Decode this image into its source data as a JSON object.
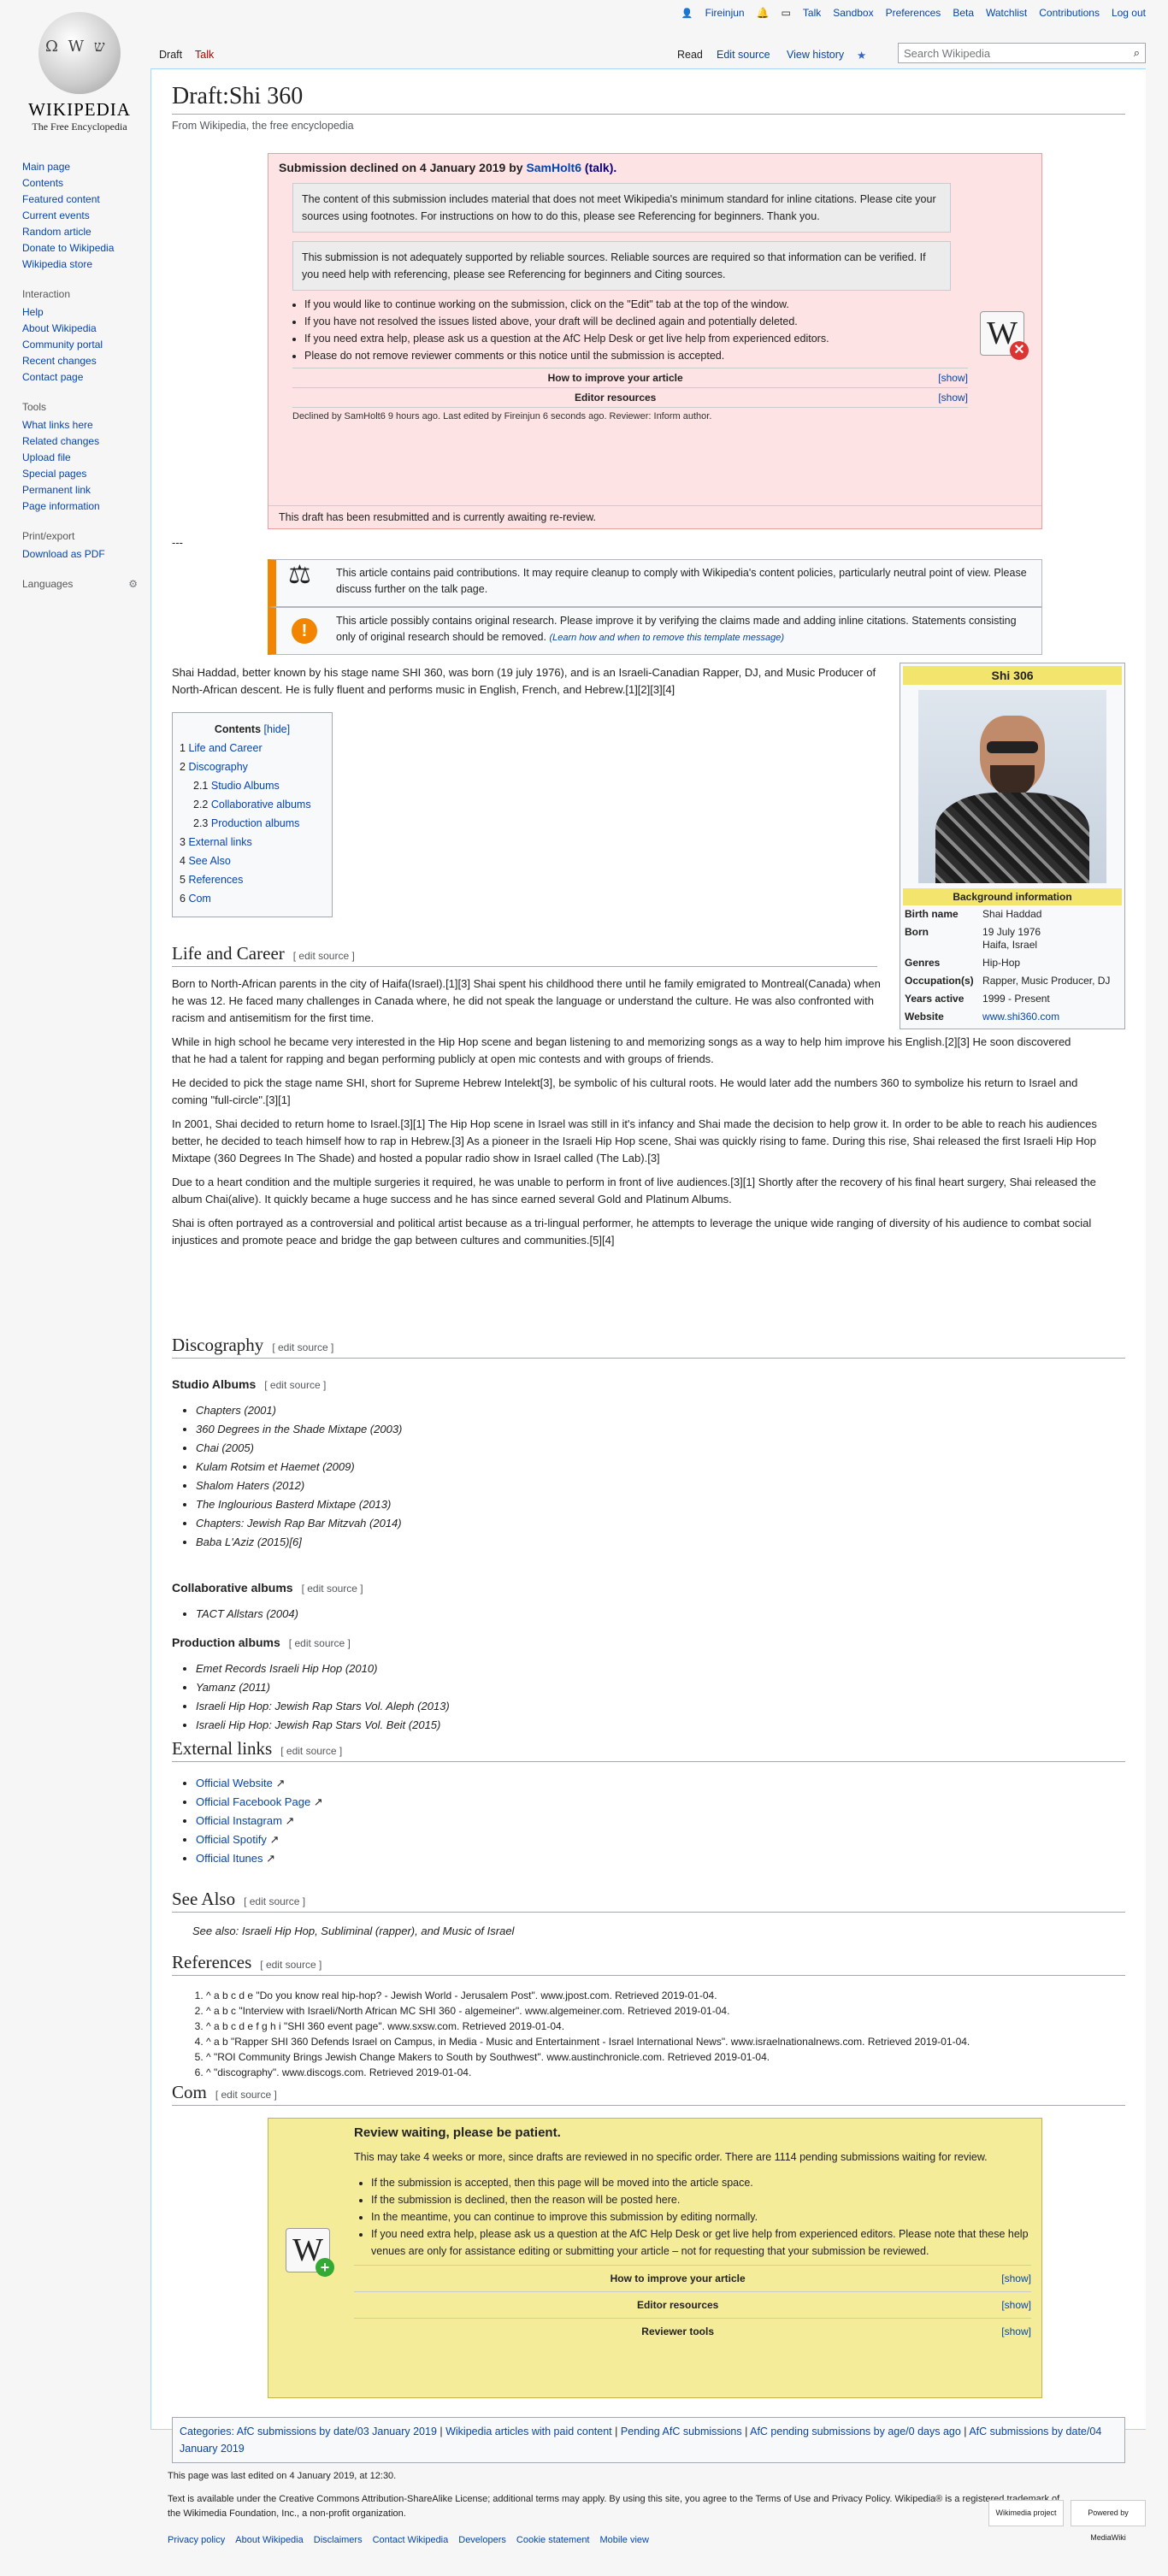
{
  "personal": [
    "Fireinjun",
    "Talk",
    "Sandbox",
    "Preferences",
    "Beta",
    "Watchlist",
    "Contributions",
    "Log out"
  ],
  "logo": {
    "name": "WIKIPEDIA",
    "tagline": "The Free Encyclopedia"
  },
  "sidebar": {
    "main": [
      "Main page",
      "Contents",
      "Featured content",
      "Current events",
      "Random article",
      "Donate to Wikipedia",
      "Wikipedia store"
    ],
    "interaction_head": "Interaction",
    "interaction": [
      "Help",
      "About Wikipedia",
      "Community portal",
      "Recent changes",
      "Contact page"
    ],
    "tools_head": "Tools",
    "tools": [
      "What links here",
      "Related changes",
      "Upload file",
      "Special pages",
      "Permanent link",
      "Page information"
    ],
    "print_head": "Print/export",
    "print": [
      "Download as PDF"
    ],
    "lang_head": "Languages"
  },
  "tabs": {
    "draft": "Draft",
    "talk": "Talk",
    "read": "Read",
    "edit": "Edit source",
    "history": "View history",
    "search_placeholder": "Search Wikipedia"
  },
  "page": {
    "title": "Draft:Shi 360",
    "from": "From Wikipedia, the free encyclopedia",
    "dashes": "---"
  },
  "decline": {
    "title_pre": "Submission declined on 4 January 2019 by ",
    "user": "SamHolt6",
    "talk": "(talk).",
    "reason1": "The content of this submission includes material that does not meet Wikipedia's minimum standard for inline citations. Please cite your sources using footnotes. For instructions on how to do this, please see Referencing for beginners. Thank you.",
    "reason2": "This submission is not adequately supported by reliable sources. Reliable sources are required so that information can be verified. If you need help with referencing, please see Referencing for beginners and Citing sources.",
    "bullets": [
      "If you would like to continue working on the submission, click on the \"Edit\" tab at the top of the window.",
      "If you have not resolved the issues listed above, your draft will be declined again and potentially deleted.",
      "If you need extra help, please ask us a question at the AfC Help Desk or get live help from experienced editors.",
      "Please do not remove reviewer comments or this notice until the submission is accepted."
    ],
    "how": "How to improve your article",
    "editor": "Editor resources",
    "show": "[show]",
    "declined_by": "Declined by SamHolt6 9 hours ago. Last edited by Fireinjun 6 seconds ago. Reviewer: Inform author.",
    "resubmitted": "This draft has been resubmitted and is currently awaiting re-review."
  },
  "issues": {
    "paid": "This article contains paid contributions. It may require cleanup to comply with Wikipedia's content policies, particularly neutral point of view. Please discuss further on the talk page.",
    "research": "This article possibly contains original research. Please improve it by verifying the claims made and adding inline citations. Statements consisting only of original research should be removed.",
    "learn": "(Learn how and when to remove this template message)"
  },
  "intro": "Shai Haddad, better known by his stage name SHI 360, was born (19 july 1976), and is an Israeli-Canadian Rapper, DJ, and Music Producer of North-African descent. He is fully fluent and performs music in English, French, and Hebrew.[1][2][3][4]",
  "infobox": {
    "title": "Shi 306",
    "section": "Background information",
    "rows": [
      {
        "k": "Birth name",
        "v": "Shai Haddad"
      },
      {
        "k": "Born",
        "v": "19 July 1976\nHaifa, Israel"
      },
      {
        "k": "Genres",
        "v": "Hip-Hop"
      },
      {
        "k": "Occupation(s)",
        "v": "Rapper, Music Producer, DJ"
      },
      {
        "k": "Years active",
        "v": "1999 - Present"
      },
      {
        "k": "Website",
        "v": "www.shi360.com"
      }
    ]
  },
  "toc": {
    "title": "Contents",
    "hide": "[hide]",
    "items": [
      {
        "n": "1",
        "t": "Life and Career",
        "lvl": 1
      },
      {
        "n": "2",
        "t": "Discography",
        "lvl": 1
      },
      {
        "n": "2.1",
        "t": "Studio Albums",
        "lvl": 2
      },
      {
        "n": "2.2",
        "t": "Collaborative albums",
        "lvl": 2
      },
      {
        "n": "2.3",
        "t": "Production albums",
        "lvl": 2
      },
      {
        "n": "3",
        "t": "External links",
        "lvl": 1
      },
      {
        "n": "4",
        "t": "See Also",
        "lvl": 1
      },
      {
        "n": "5",
        "t": "References",
        "lvl": 1
      },
      {
        "n": "6",
        "t": "Com",
        "lvl": 1
      }
    ]
  },
  "edit_source": "[ edit source ]",
  "life": {
    "heading": "Life and Career",
    "paras": [
      "Born to North-African parents in the city of Haifa(Israel).[1][3] Shai spent his childhood there until he family emigrated to Montreal(Canada) when he was 12. He faced many challenges in Canada where, he did not speak the language or understand the culture. He was also confronted with racism and antisemitism for the first time.",
      "While in high school he became very interested in the Hip Hop scene and began listening to and memorizing songs as a way to help him improve his English.[2][3] He soon discovered that he had a talent for rapping and began performing publicly at open mic contests and with groups of friends.",
      "He decided to pick the stage name SHI, short for Supreme Hebrew Intelekt[3], be symbolic of his cultural roots. He would later add the numbers 360 to symbolize his return to Israel and coming \"full-circle\".[3][1]",
      "In 2001, Shai decided to return home to Israel.[3][1] The Hip Hop scene in Israel was still in it's infancy and Shai made the decision to help grow it. In order to be able to reach his audiences better, he decided to teach himself how to rap in Hebrew.[3] As a pioneer in the Israeli Hip Hop scene, Shai was quickly rising to fame. During this rise, Shai released the first Israeli Hip Hop Mixtape (360 Degrees In The Shade) and hosted a popular radio show in Israel called (The Lab).[3]",
      "Due to a heart condition and the multiple surgeries it required, he was unable to perform in front of live audiences.[3][1] Shortly after the recovery of his final heart surgery, Shai released the album Chai(alive). It quickly became a huge success and he has since earned several Gold and Platinum Albums.",
      "Shai is often portrayed as a controversial and political artist because as a tri-lingual performer, he attempts to leverage the unique wide ranging of diversity of his audience to combat social injustices and promote peace and bridge the gap between cultures and communities.[5][4]"
    ]
  },
  "discography": {
    "heading": "Discography",
    "studio_head": "Studio Albums",
    "studio": [
      "Chapters (2001)",
      "360 Degrees in the Shade Mixtape (2003)",
      "Chai (2005)",
      "Kulam Rotsim et Haemet (2009)",
      "Shalom Haters (2012)",
      "The Inglourious Basterd Mixtape (2013)",
      "Chapters: Jewish Rap Bar Mitzvah (2014)",
      "Baba L'Aziz (2015)[6]"
    ],
    "collab_head": "Collaborative albums",
    "collab": [
      "TACT Allstars (2004)"
    ],
    "prod_head": "Production albums",
    "prod": [
      "Emet Records Israeli Hip Hop (2010)",
      "Yamanz (2011)",
      "Israeli Hip Hop: Jewish Rap Stars Vol. Aleph (2013)",
      "Israeli Hip Hop: Jewish Rap Stars Vol. Beit (2015)"
    ]
  },
  "external": {
    "heading": "External links",
    "items": [
      "Official Website",
      "Official Facebook Page",
      "Official Instagram",
      "Official Spotify",
      "Official Itunes"
    ]
  },
  "seealso": {
    "heading": "See Also",
    "text": "See also: Israeli Hip Hop, Subliminal (rapper), and Music of Israel"
  },
  "references": {
    "heading": "References",
    "items": [
      "^ a b c d e \"Do you know real hip-hop? - Jewish World - Jerusalem Post\". www.jpost.com. Retrieved 2019-01-04.",
      "^ a b c \"Interview with Israeli/North African MC SHI 360 - algemeiner\". www.algemeiner.com. Retrieved 2019-01-04.",
      "^ a b c d e f g h i \"SHI 360 event page\". www.sxsw.com. Retrieved 2019-01-04.",
      "^ a b \"Rapper SHI 360 Defends Israel on Campus, in Media - Music and Entertainment - Israel International News\". www.israelnationalnews.com. Retrieved 2019-01-04.",
      "^ \"ROI Community Brings Jewish Change Makers to South by Southwest\". www.austinchronicle.com. Retrieved 2019-01-04.",
      "^ \"discography\". www.discogs.com. Retrieved 2019-01-04."
    ]
  },
  "com": {
    "heading": "Com"
  },
  "review": {
    "title": "Review waiting, please be patient.",
    "text": "This may take 4 weeks or more, since drafts are reviewed in no specific order. There are 1114 pending submissions waiting for review.",
    "bullets": [
      "If the submission is accepted, then this page will be moved into the article space.",
      "If the submission is declined, then the reason will be posted here.",
      "In the meantime, you can continue to improve this submission by editing normally.",
      "If you need extra help, please ask us a question at the AfC Help Desk or get live help from experienced editors. Please note that these help venues are only for assistance editing or submitting your article – not for requesting that your submission be reviewed."
    ],
    "rows": [
      "How to improve your article",
      "Editor resources",
      "Reviewer tools"
    ],
    "show": "[show]"
  },
  "categories": {
    "label": "Categories:",
    "items": [
      "AfC submissions by date/03 January 2019",
      "Wikipedia articles with paid content",
      "Pending AfC submissions",
      "AfC pending submissions by age/0 days ago",
      "AfC submissions by date/04 January 2019"
    ]
  },
  "footer": {
    "last_edit": "This page was last edited on 4 January 2019, at 12:30.",
    "license": "Text is available under the Creative Commons Attribution-ShareAlike License; additional terms may apply. By using this site, you agree to the Terms of Use and Privacy Policy. Wikipedia® is a registered trademark of the Wikimedia Foundation, Inc., a non-profit organization.",
    "links": [
      "Privacy policy",
      "About Wikipedia",
      "Disclaimers",
      "Contact Wikipedia",
      "Developers",
      "Cookie statement",
      "Mobile view"
    ],
    "badge1": "Wikimedia project",
    "badge2": "Powered by MediaWiki"
  }
}
